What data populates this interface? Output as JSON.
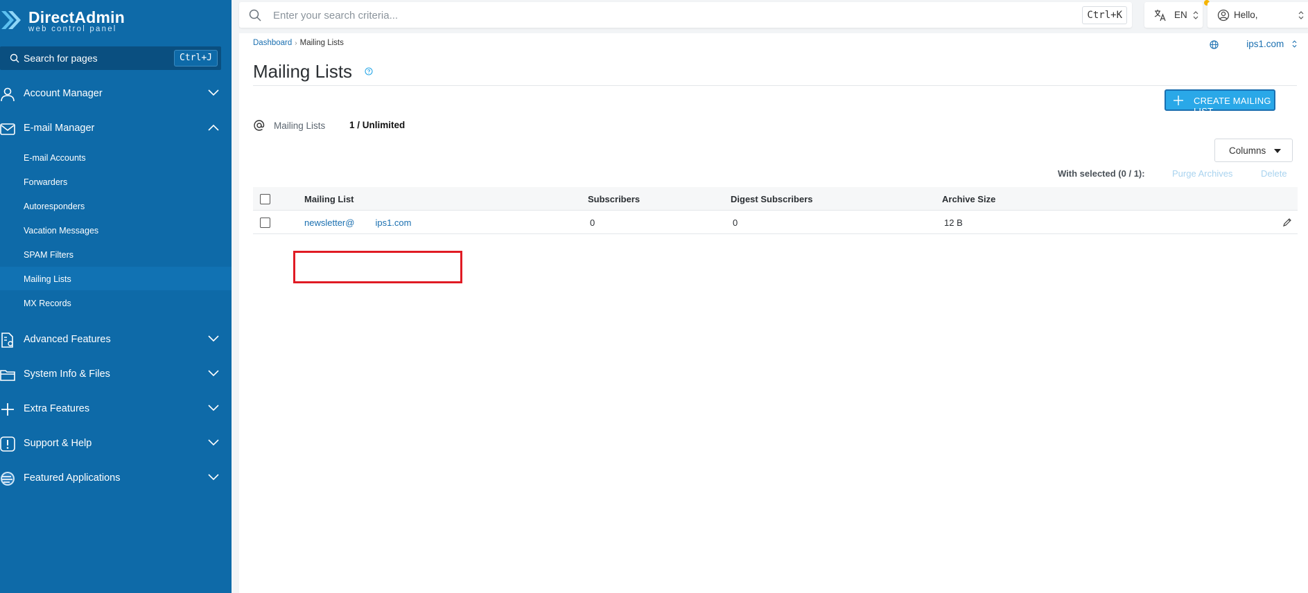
{
  "brand": {
    "title": "DirectAdmin",
    "subtitle": "web control panel"
  },
  "sidebar": {
    "search_label": "Search for pages",
    "search_shortcut": "Ctrl+J",
    "items": [
      {
        "label": "Account Manager",
        "icon": "user-icon"
      },
      {
        "label": "E-mail Manager",
        "icon": "mail-icon",
        "expanded": true
      },
      {
        "label": "Advanced Features",
        "icon": "advanced-icon"
      },
      {
        "label": "System Info & Files",
        "icon": "folder-icon"
      },
      {
        "label": "Extra Features",
        "icon": "plus-icon"
      },
      {
        "label": "Support & Help",
        "icon": "alert-icon"
      },
      {
        "label": "Featured Applications",
        "icon": "apps-icon"
      }
    ],
    "email_sub": [
      "E-mail Accounts",
      "Forwarders",
      "Autoresponders",
      "Vacation Messages",
      "SPAM Filters",
      "Mailing Lists",
      "MX Records"
    ],
    "active_sub": "Mailing Lists"
  },
  "topbar": {
    "search_placeholder": "Enter your search criteria...",
    "search_shortcut": "Ctrl+K",
    "language": "EN",
    "greeting": "Hello,"
  },
  "breadcrumb": {
    "home": "Dashboard",
    "current": "Mailing Lists"
  },
  "domain": "ips1.com",
  "page": {
    "title": "Mailing Lists",
    "create_label": "CREATE MAILING LIST",
    "usage_label": "Mailing Lists",
    "usage_value": "1 / Unlimited",
    "columns_label": "Columns",
    "with_selected": "With selected (0 / 1):",
    "purge_label": "Purge Archives",
    "delete_label": "Delete"
  },
  "table": {
    "headers": [
      "Mailing List",
      "Subscribers",
      "Digest Subscribers",
      "Archive Size"
    ],
    "rows": [
      {
        "list_user": "newsletter@",
        "list_domain": "ips1.com",
        "subscribers": "0",
        "digest": "0",
        "archive": "12 B"
      }
    ]
  },
  "colors": {
    "sidebar": "#0e6aa8",
    "accent": "#2aa8e8",
    "link": "#1a6fb0",
    "highlight": "#e01b24"
  }
}
